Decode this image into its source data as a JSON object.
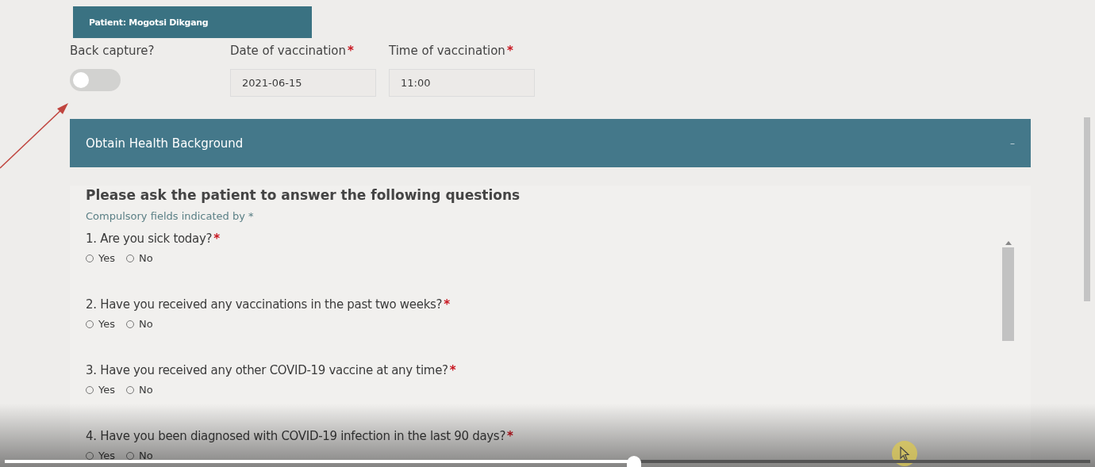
{
  "patient_tab": {
    "label": "Patient: Mogotsi Dikgang"
  },
  "back_capture": {
    "label": "Back capture?",
    "on": false
  },
  "fields": [
    {
      "label": "Date of vaccination",
      "mark": "*",
      "value": "2021-06-15"
    },
    {
      "label": "Time of vaccination",
      "mark": "*",
      "value": "11:00"
    }
  ],
  "panel": {
    "title": "Obtain Health Background",
    "collapse_symbol": "–",
    "heading": "Please ask the patient to answer the following questions",
    "note": "Compulsory fields indicated by *",
    "questions": [
      {
        "text": "1. Are you sick today?",
        "mark": "*",
        "options": [
          {
            "label": "Yes",
            "selected": false
          },
          {
            "label": "No",
            "selected": false
          }
        ]
      },
      {
        "text": "2. Have you received any vaccinations in the past two weeks?",
        "mark": "*",
        "options": [
          {
            "label": "Yes",
            "selected": false
          },
          {
            "label": "No",
            "selected": false
          }
        ]
      },
      {
        "text": "3. Have you received any other COVID-19 vaccine at any time?",
        "mark": "*",
        "options": [
          {
            "label": "Yes",
            "selected": false
          },
          {
            "label": "No",
            "selected": false
          }
        ]
      },
      {
        "text": "4. Have you been diagnosed with COVID-19 infection in the last 90 days?",
        "mark": "*",
        "options": [
          {
            "label": "Yes",
            "selected": false
          },
          {
            "label": "No",
            "selected": false
          }
        ]
      }
    ]
  },
  "video_progress": {
    "level": 0.58
  }
}
